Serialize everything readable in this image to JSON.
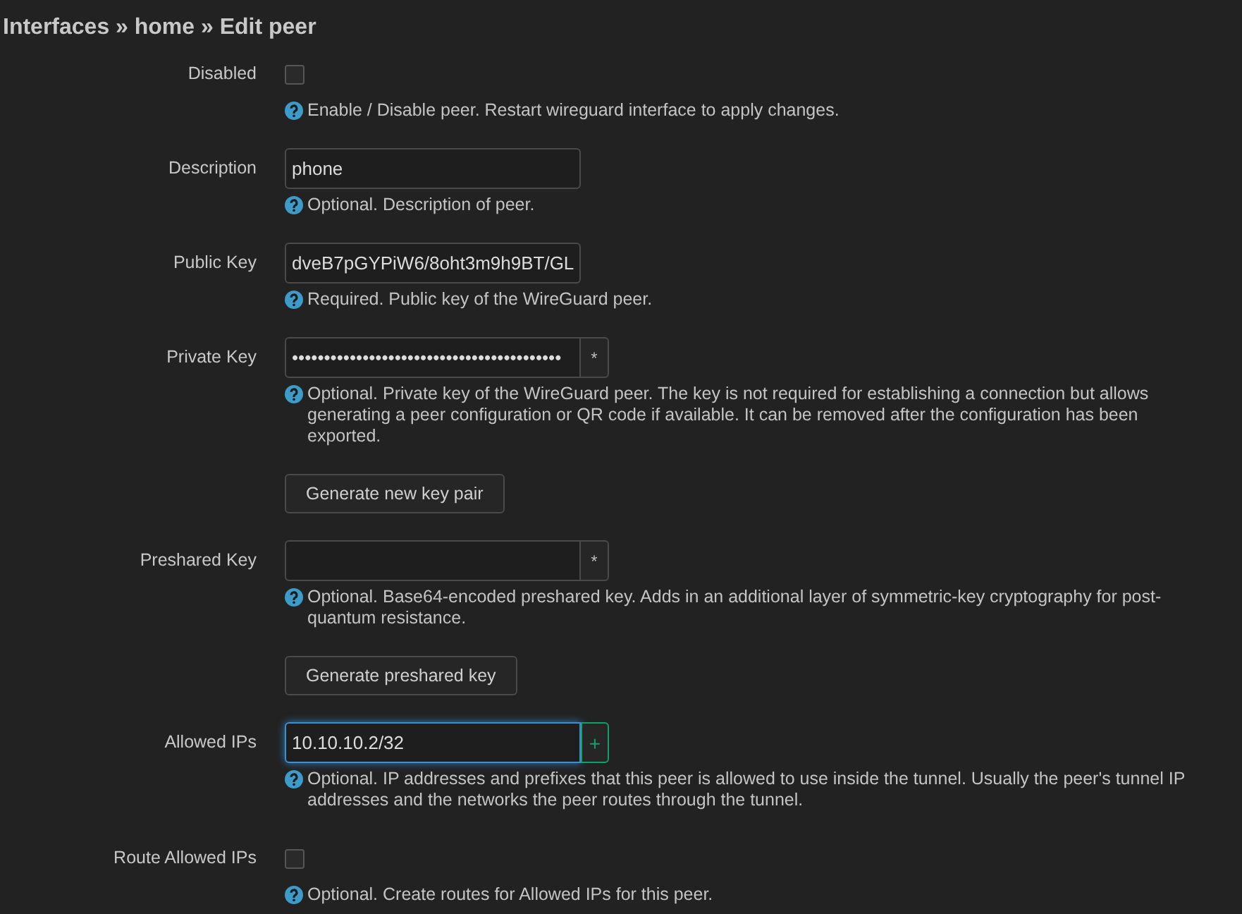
{
  "breadcrumb": "Interfaces » home » Edit peer",
  "fields": [
    {
      "kind": "checkbox",
      "label": "Disabled",
      "checked": false,
      "help": "Enable / Disable peer. Restart wireguard interface to apply changes."
    },
    {
      "kind": "text",
      "label": "Description",
      "value": "phone",
      "help": "Optional. Description of peer."
    },
    {
      "kind": "text",
      "label": "Public Key",
      "value": "dveB7pGYPiW6/8oht3m9h9BT/GL",
      "help": "Required. Public key of the WireGuard peer."
    },
    {
      "kind": "password",
      "label": "Private Key",
      "value": "••••••••••••••••••••••••••••••••••••••••••",
      "addon": "*",
      "help": "Optional. Private key of the WireGuard peer. The key is not required for establishing a connection but allows generating a peer configuration or QR code if available. It can be removed after the configuration has been exported.",
      "action": "Generate new key pair"
    },
    {
      "kind": "password",
      "label": "Preshared Key",
      "addon": "*",
      "help": "Optional. Base64-encoded preshared key. Adds in an additional layer of symmetric-key cryptography for post-quantum resistance.",
      "action": "Generate preshared key"
    },
    {
      "kind": "list",
      "label": "Allowed IPs",
      "value": "10.10.10.2/32",
      "addon": "+",
      "focused": true,
      "help": "Optional. IP addresses and prefixes that this peer is allowed to use inside the tunnel. Usually the peer's tunnel IP addresses and the networks the peer routes through the tunnel."
    },
    {
      "kind": "checkbox",
      "label": "Route Allowed IPs",
      "checked": false,
      "help": "Optional. Create routes for Allowed IPs for this peer."
    }
  ]
}
